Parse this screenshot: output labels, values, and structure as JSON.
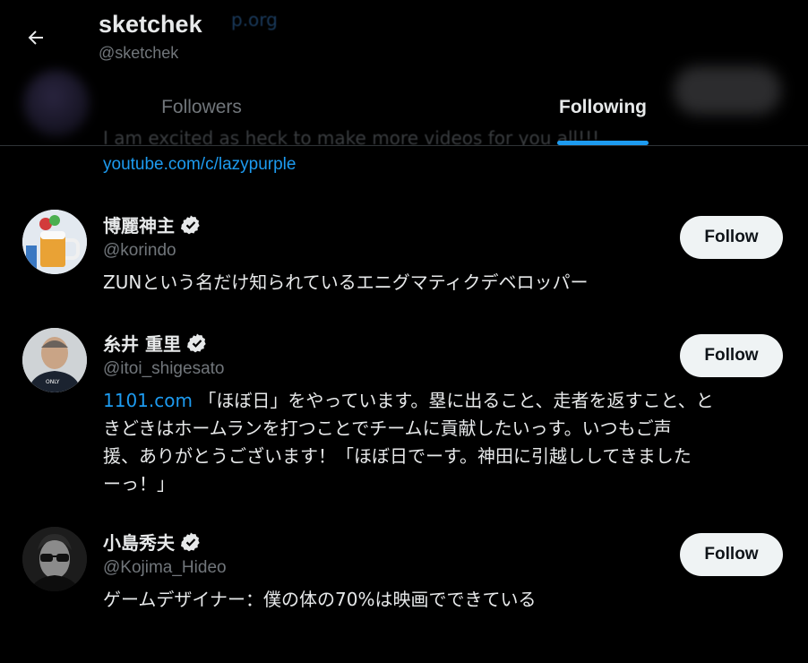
{
  "header": {
    "name": "sketchek",
    "handle": "@sketchek",
    "ghost_url": "p.org",
    "ghost_bio": "I am excited as heck to make more videos for you all!!!",
    "tabs": [
      {
        "label": "Followers",
        "selected": false
      },
      {
        "label": "Following",
        "selected": true
      }
    ],
    "accent_color": "#1d9bf0"
  },
  "bio_link": "youtube.com/c/lazypurple",
  "users": [
    {
      "name": "博麗神主",
      "handle": "@korindo",
      "verified": true,
      "bio": "ZUNという名だけ知られているエニグマティクデベロッパー",
      "follow_label": "Follow"
    },
    {
      "name": "糸井 重里",
      "handle": "@itoi_shigesato",
      "verified": true,
      "bio_link": "1101.com",
      "bio_lines": [
        "「ほぼ日」をやっています。塁に出ること、走者を返すこと、と",
        "きどきはホームランを打つことでチームに貢献したいっす。いつもご声",
        "援、ありがとうございます！「ほぼ日でーす。神田に引越ししてきました",
        "ーっ！」"
      ],
      "follow_label": "Follow"
    },
    {
      "name": "小島秀夫",
      "handle": "@Kojima_Hideo",
      "verified": true,
      "bio": "ゲームデザイナー：僕の体の70%は映画でできている",
      "follow_label": "Follow"
    }
  ]
}
